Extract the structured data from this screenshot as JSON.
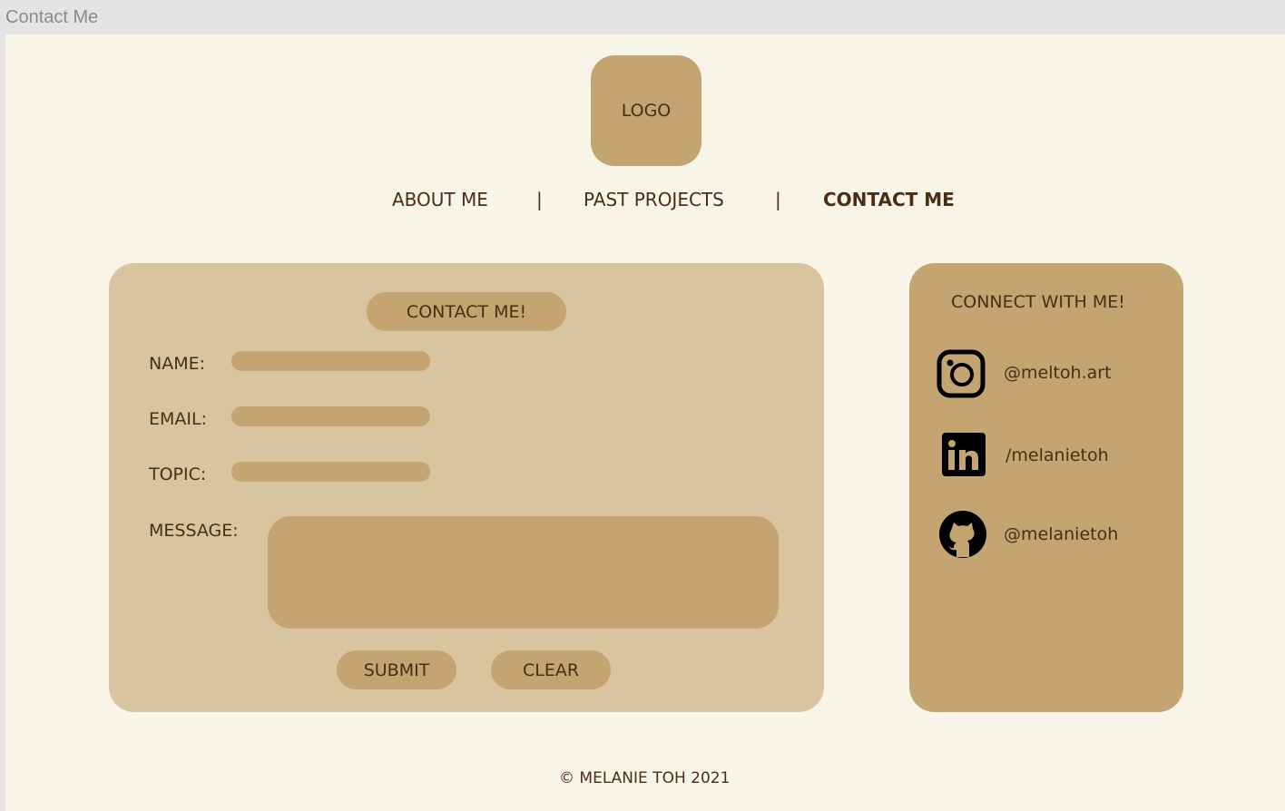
{
  "window": {
    "title": "Contact Me"
  },
  "logo": "LOGO",
  "nav": {
    "about": "ABOUT ME",
    "sep": "|",
    "projects": "PAST PROJECTS",
    "contact": "CONTACT ME"
  },
  "form": {
    "title": "CONTACT ME!",
    "name_label": "NAME:",
    "email_label": "EMAIL:",
    "topic_label": "TOPIC:",
    "message_label": "MESSAGE:",
    "submit": "SUBMIT",
    "clear": "CLEAR"
  },
  "connect": {
    "title": "CONNECT WITH ME!",
    "instagram": "@meltoh.art",
    "linkedin": "/melanietoh",
    "github": "@melanietoh"
  },
  "footer": "© MELANIE TOH 2021"
}
